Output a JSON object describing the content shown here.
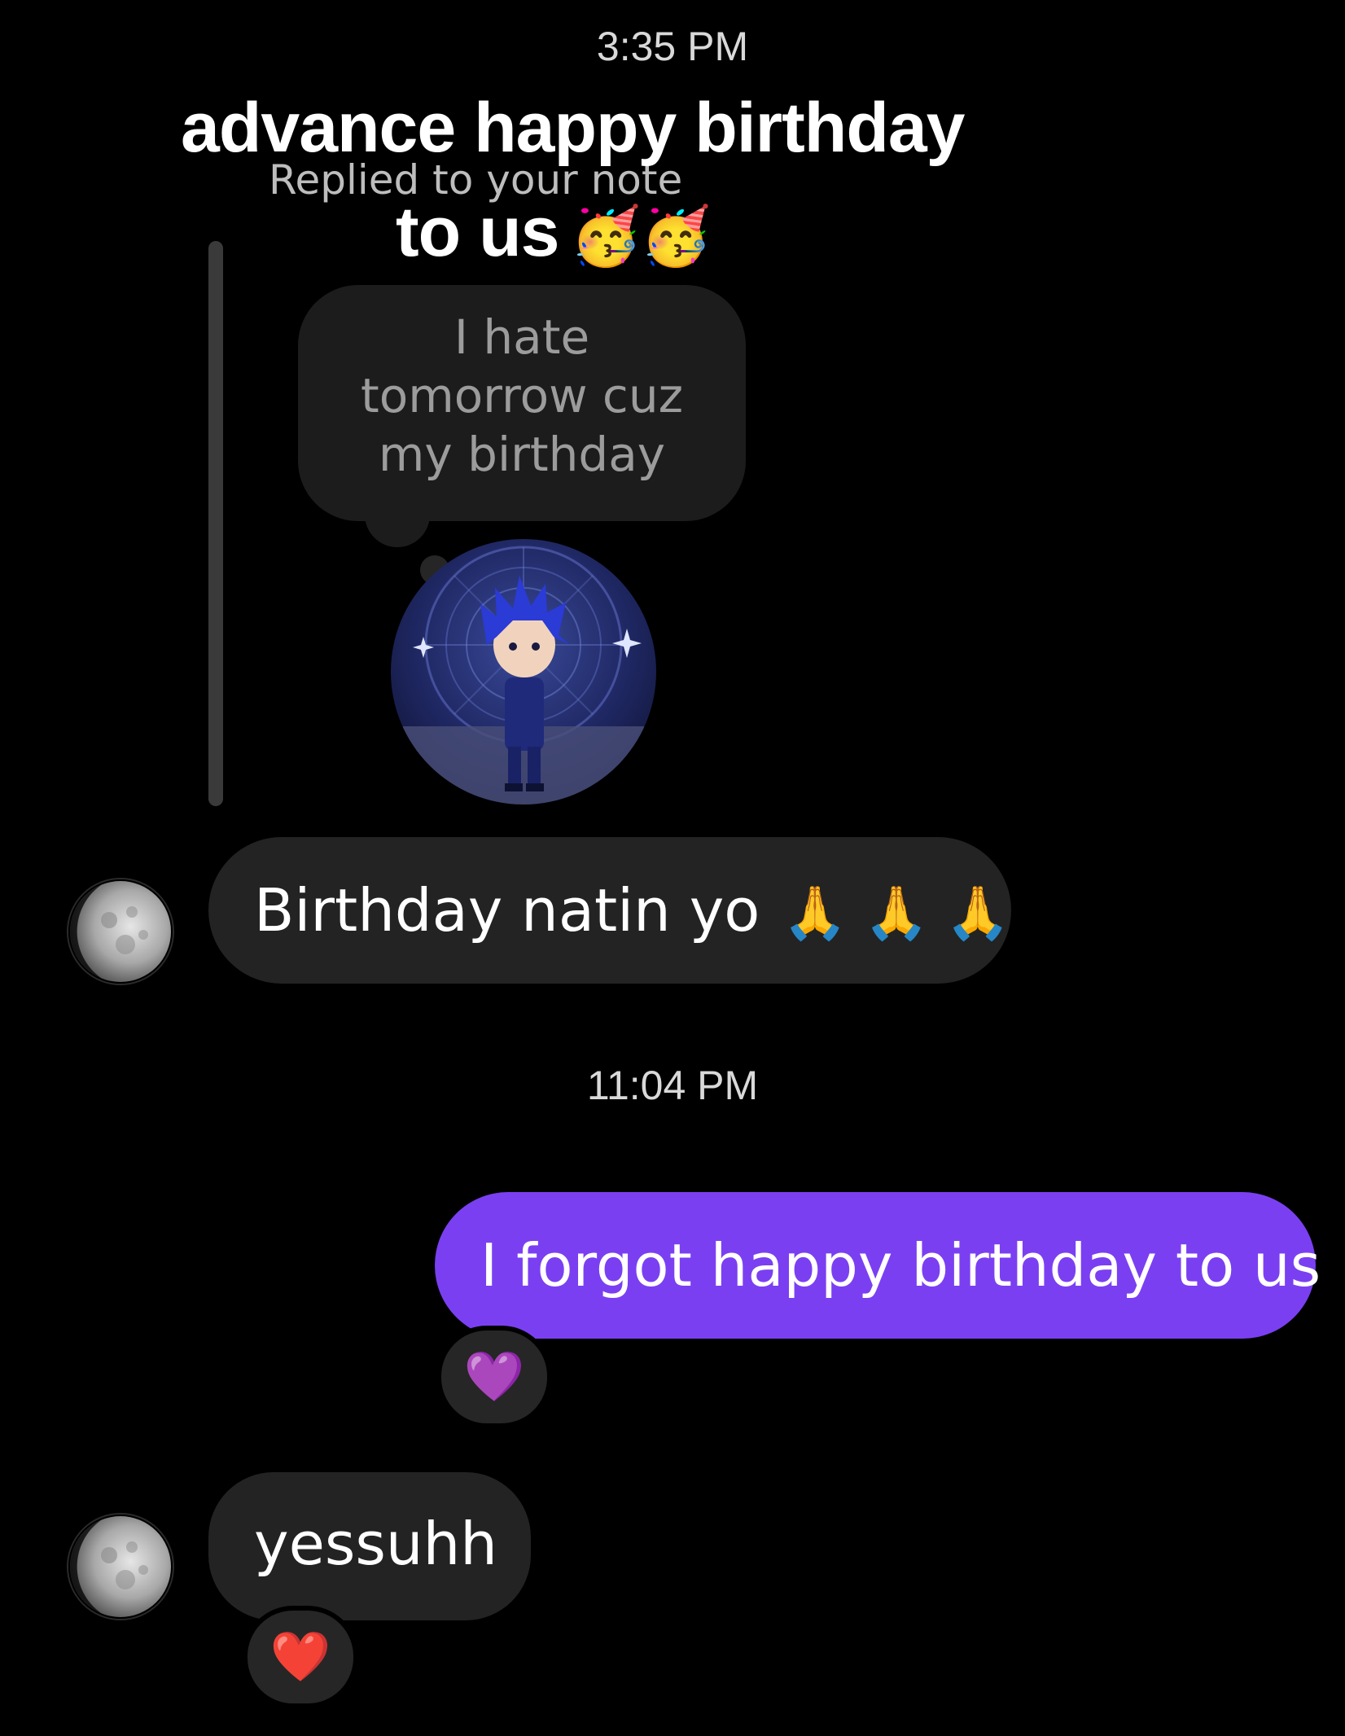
{
  "conversation": {
    "timestamp_1": "3:35 PM",
    "overlay_caption": {
      "line1": "advance happy birthday",
      "line2": "to us",
      "line2_emoji": "🥳🥳"
    },
    "reply_context": {
      "label": "Replied to your note",
      "note_lines": [
        "I hate",
        "tomorrow cuz",
        "my birthday"
      ],
      "note_avatar": "anime-character-avatar"
    },
    "message_1": {
      "text": "Birthday natin yo",
      "emoji": "🙏 🙏 🙏",
      "avatar": "moon-avatar"
    },
    "timestamp_2": "11:04 PM",
    "message_2": {
      "text": "I forgot happy birthday to us",
      "reaction": "💜"
    },
    "message_3": {
      "text": "yessuhh",
      "reaction": "❤️",
      "avatar": "moon-avatar"
    }
  },
  "colors": {
    "background": "#000000",
    "incoming_bubble": "#232323",
    "outgoing_bubble": "#7b3ff2",
    "note_bubble": "#1c1c1c"
  }
}
